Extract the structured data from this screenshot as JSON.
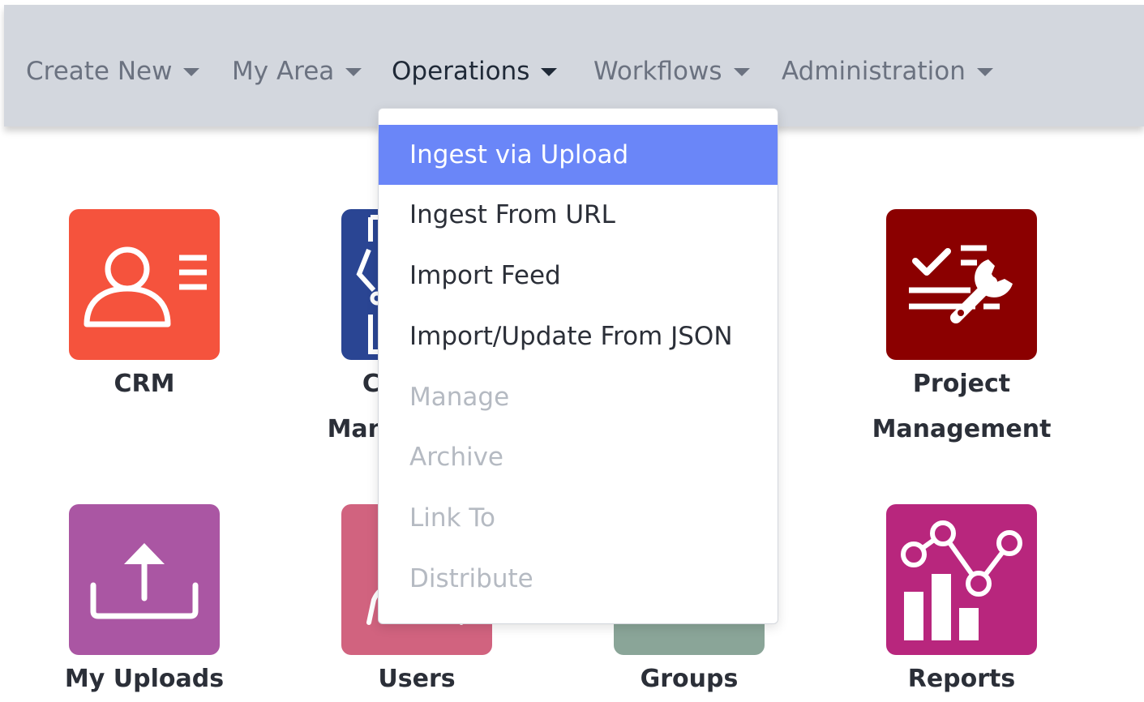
{
  "nav": {
    "items": [
      {
        "label": "Create New"
      },
      {
        "label": "My Area"
      },
      {
        "label": "Operations"
      },
      {
        "label": "Workflows"
      },
      {
        "label": "Administration"
      }
    ]
  },
  "tiles": [
    {
      "label": "CRM",
      "icon": "crm-contact-icon",
      "color": "#f5533d"
    },
    {
      "label_line1": "Content",
      "label_line2": "Management",
      "icon": "content-management-icon",
      "color": "#2a4593"
    },
    {
      "label_line1": "Project",
      "label_line2": "Management",
      "icon": "project-management-icon",
      "color": "#8b0000"
    },
    {
      "label": "My Uploads",
      "icon": "upload-icon",
      "color": "#aa56a3"
    },
    {
      "label": "Users",
      "icon": "users-icon",
      "color": "#d1637f"
    },
    {
      "label": "Groups",
      "icon": "groups-icon",
      "color": "#8aa598"
    },
    {
      "label": "Reports",
      "icon": "reports-chart-icon",
      "color": "#b8267d"
    }
  ],
  "dropdown": {
    "items": [
      {
        "label": "Ingest via Upload",
        "state": "highlighted"
      },
      {
        "label": "Ingest From URL",
        "state": "enabled"
      },
      {
        "label": "Import Feed",
        "state": "enabled"
      },
      {
        "label": "Import/Update From JSON",
        "state": "enabled"
      },
      {
        "label": "Manage",
        "state": "disabled"
      },
      {
        "label": "Archive",
        "state": "disabled"
      },
      {
        "label": "Link To",
        "state": "disabled"
      },
      {
        "label": "Distribute",
        "state": "disabled"
      }
    ]
  },
  "colors": {
    "navbar_bg": "#d3d7de",
    "highlight": "#6a86f8",
    "disabled_text": "#b5bac2"
  }
}
